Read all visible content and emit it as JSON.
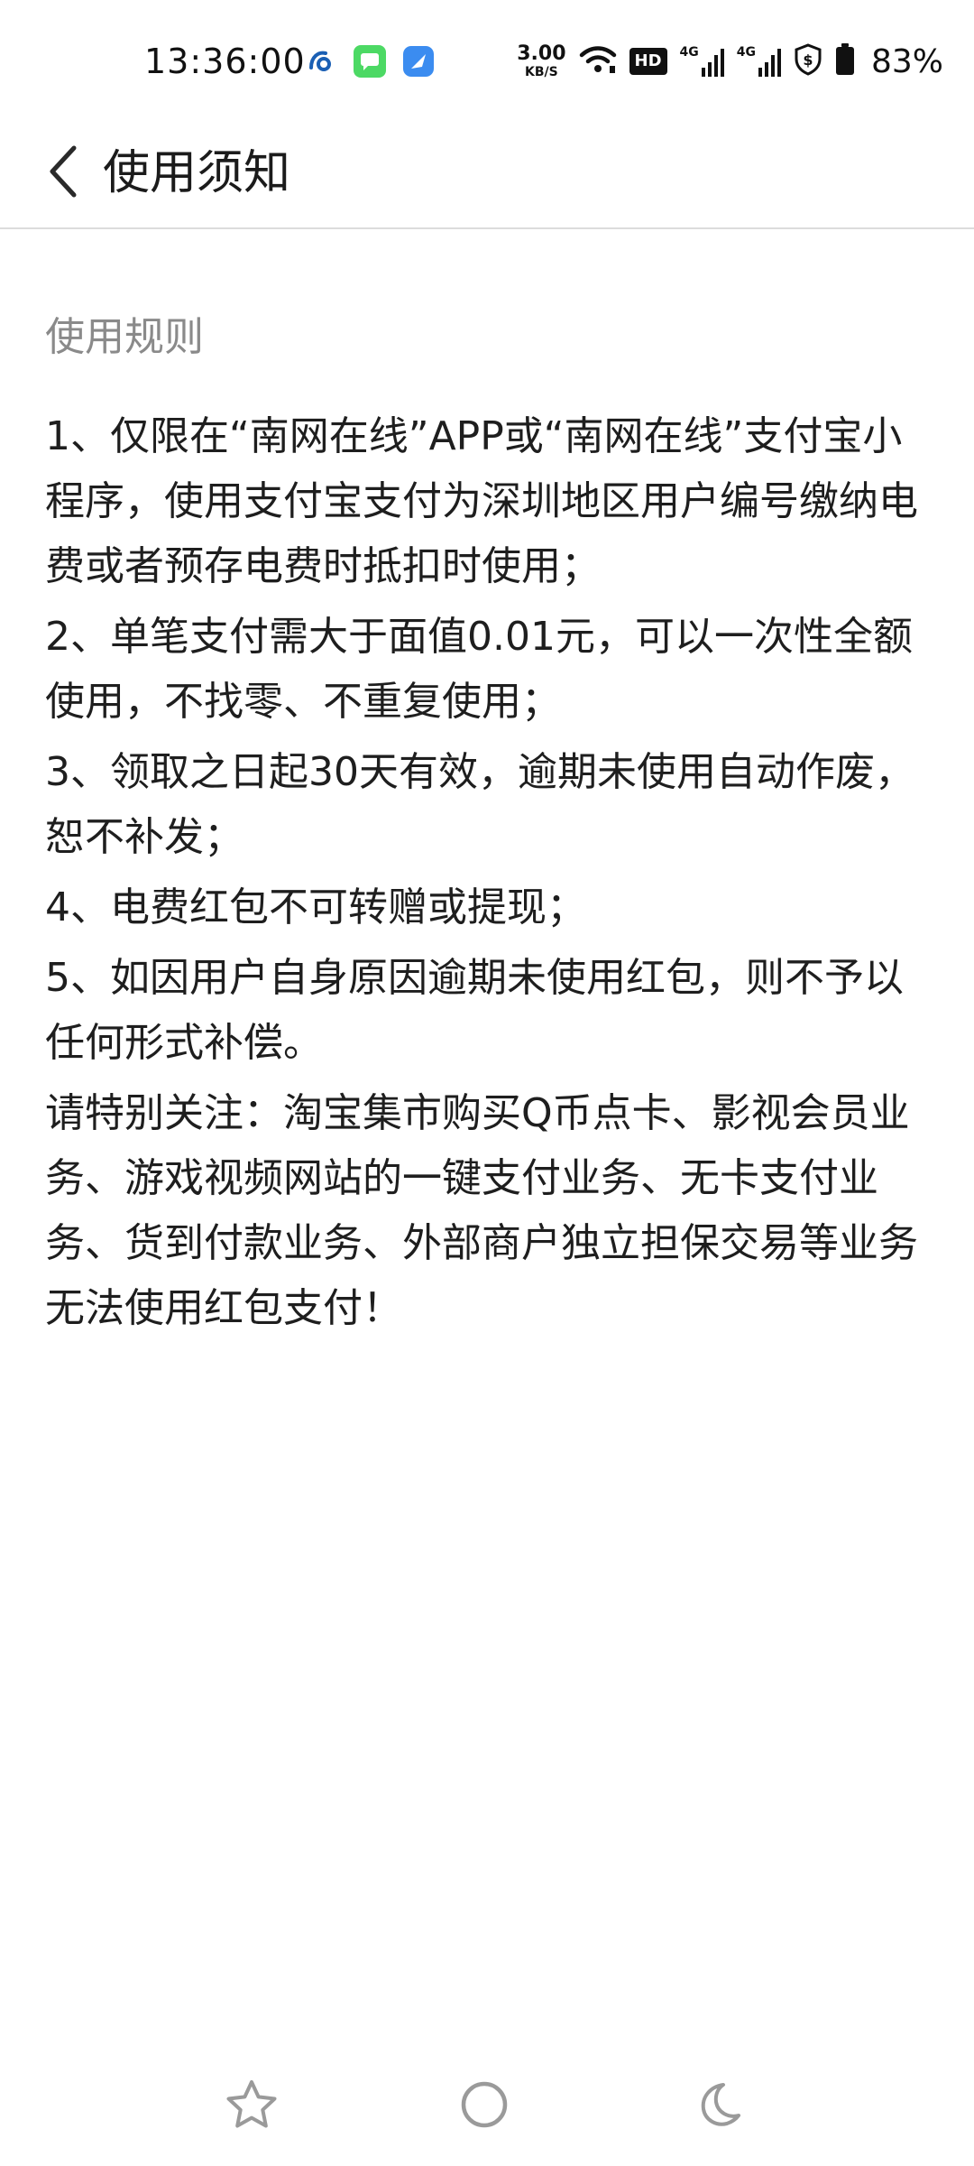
{
  "status_bar": {
    "time": "13:36:00",
    "net_speed_value": "3.00",
    "net_speed_unit": "KB/S",
    "hd_label": "HD",
    "network_1": "4G",
    "network_2": "4G",
    "battery_percent": "83%"
  },
  "header": {
    "title": "使用须知"
  },
  "content": {
    "section_title": "使用规则",
    "rules": [
      "1、仅限在“南网在线”APP或“南网在线”支付宝小程序，使用支付宝支付为深圳地区用户编号缴纳电费或者预存电费时抵扣时使用；",
      "2、单笔支付需大于面值0.01元，可以一次性全额使用，不找零、不重复使用；",
      "3、领取之日起30天有效，逾期未使用自动作废，恕不补发；",
      "4、电费红包不可转赠或提现；",
      "5、如因用户自身原因逾期未使用红包，则不予以任何形式补偿。",
      "请特别关注：淘宝集市购买Q币点卡、影视会员业务、游戏视频网站的一键支付业务、无卡支付业务、货到付款业务、外部商户独立担保交易等业务无法使用红包支付！"
    ]
  },
  "icons": {
    "back": "chevron-left-icon",
    "favorite": "star-icon",
    "home": "circle-icon",
    "night_mode": "moon-icon"
  },
  "colors": {
    "text": "#1e1e1e",
    "section_title": "#8a8a8a",
    "divider": "#dcdcdc",
    "toolbar_icon": "#9a9a9a"
  }
}
